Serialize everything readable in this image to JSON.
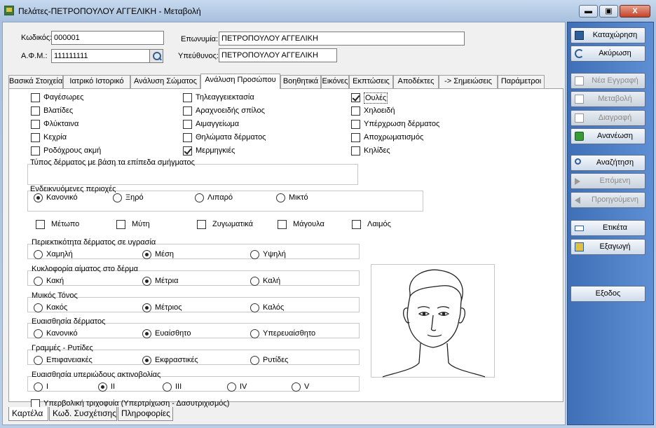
{
  "window": {
    "title": "Πελάτες-ΠΕΤΡΟΠΟΥΛΟΥ ΑΓΓΕΛΙΚΗ -  Μεταβολή",
    "min_label": "▬",
    "max_label": "▣",
    "close_label": "X"
  },
  "header": {
    "code_label": "Κωδικός:",
    "code_value": "000001",
    "afm_label": "Α.Φ.Μ.:",
    "afm_value": "111111111",
    "name_label": "Επωνυμία:",
    "name_value": "ΠΕΤΡΟΠΟΥΛΟΥ ΑΓΓΕΛΙΚΗ",
    "resp_label": "Υπεύθυνος:",
    "resp_value": "ΠΕΤΡΟΠΟΥΛΟΥ ΑΓΓΕΛΙΚΗ"
  },
  "tabs": [
    {
      "label": "Βασικά Στοιχεία"
    },
    {
      "label": "Ιατρικό Ιστορικό"
    },
    {
      "label": "Ανάλυση Σώματος"
    },
    {
      "label": "Ανάλυση Προσώπου"
    },
    {
      "label": "Βοηθητικά"
    },
    {
      "label": "Εικόνες"
    },
    {
      "label": "Εκπτώσεις"
    },
    {
      "label": "Αποδέκτες"
    },
    {
      "label": "-> Σημειώσεις"
    },
    {
      "label": "Παράμετροι"
    }
  ],
  "active_tab": "Ανάλυση Προσώπου",
  "conditions": [
    {
      "label": "Φαγέσωρες",
      "checked": false
    },
    {
      "label": "Βλατίδες",
      "checked": false
    },
    {
      "label": "Φλύκταινα",
      "checked": false
    },
    {
      "label": "Κεχρία",
      "checked": false
    },
    {
      "label": "Ροδόχρους ακμή",
      "checked": false
    },
    {
      "label": "Τηλεαγγειεκτασία",
      "checked": false
    },
    {
      "label": "Αραχνοειδής σπίλος",
      "checked": false
    },
    {
      "label": "Αιμαγγείωμα",
      "checked": false
    },
    {
      "label": "Θηλώματα δέρματος",
      "checked": false
    },
    {
      "label": "Μερμηγκιές",
      "checked": true
    },
    {
      "label": "Ουλές",
      "checked": true
    },
    {
      "label": "Χηλοειδή",
      "checked": false
    },
    {
      "label": "Υπέρχρωση δέρματος",
      "checked": false
    },
    {
      "label": "Αποχρωματισμός",
      "checked": false
    },
    {
      "label": "Κηλίδες",
      "checked": false
    }
  ],
  "skin_type": {
    "title": "Τύπος δέρματος με βάση τα επίπεδα σμήγματος",
    "options": [
      "Κανονικό",
      "Ξηρό",
      "Λιπαρό",
      "Μικτό"
    ],
    "selected": "Κανονικό"
  },
  "areas": {
    "title": "Ενδεικνυόμενες περιοχές",
    "items": [
      {
        "label": "Μέτωπο",
        "checked": false
      },
      {
        "label": "Μύτη",
        "checked": false
      },
      {
        "label": "Ζυγωματικά",
        "checked": false
      },
      {
        "label": "Μάγουλα",
        "checked": false
      },
      {
        "label": "Λαιμός",
        "checked": false
      }
    ]
  },
  "moisture": {
    "title": "Περιεκτικότητα δέρματος σε υγρασία",
    "options": [
      "Χαμηλή",
      "Μέση",
      "Υψηλή"
    ],
    "selected": "Μέση"
  },
  "circulation": {
    "title": "Κυκλοφορία αίματος στο δέρμα",
    "options": [
      "Κακή",
      "Μέτρια",
      "Καλή"
    ],
    "selected": "Μέτρια"
  },
  "muscle_tone": {
    "title": "Μυικός Τόνος",
    "options": [
      "Κακός",
      "Μέτριος",
      "Καλός"
    ],
    "selected": "Μέτριος"
  },
  "sensitivity": {
    "title": "Ευαισθησία δέρματος",
    "options": [
      "Κανονικό",
      "Ευαίσθητο",
      "Υπερευαίσθητο"
    ],
    "selected": "Ευαίσθητο"
  },
  "wrinkles": {
    "title": "Γραμμές - Ρυτίδες",
    "options": [
      "Επιφανειακές",
      "Εκφραστικές",
      "Ρυτίδες"
    ],
    "selected": "Εκφραστικές"
  },
  "uv": {
    "title": "Ευαισθησία υπεριώδους ακτινοβολίας",
    "options": [
      "I",
      "II",
      "III",
      "IV",
      "V"
    ],
    "selected": "II"
  },
  "hypertrichosis": {
    "label": "Υπερβολική τριχοφυία (Υπερτρίχωση - Δασυτριχισμός)",
    "checked": false
  },
  "bottom_tabs": [
    {
      "label": "Καρτέλα"
    },
    {
      "label": "Κωδ. Συσχέτισης"
    },
    {
      "label": "Πληροφορίες"
    }
  ],
  "sidebar": {
    "buttons": [
      {
        "label": "Καταχώρηση",
        "icon": "save-icon",
        "enabled": true
      },
      {
        "label": "Ακύρωση",
        "icon": "undo-icon",
        "enabled": true
      },
      {
        "label": "Νέα Εγγραφή",
        "icon": "new-record-icon",
        "enabled": false
      },
      {
        "label": "Μεταβολή",
        "icon": "edit-icon",
        "enabled": false
      },
      {
        "label": "Διαγραφή",
        "icon": "delete-icon",
        "enabled": false
      },
      {
        "label": "Ανανέωση",
        "icon": "refresh-icon",
        "enabled": true
      },
      {
        "label": "Αναζήτηση",
        "icon": "search-icon",
        "enabled": true
      },
      {
        "label": "Επόμενη",
        "icon": "arrow-right-icon",
        "enabled": false
      },
      {
        "label": "Προηγούμενη",
        "icon": "arrow-left-icon",
        "enabled": false
      },
      {
        "label": "Ετικέτα",
        "icon": "label-icon",
        "enabled": true
      },
      {
        "label": "Εξαγωγή",
        "icon": "export-icon",
        "enabled": true
      },
      {
        "label": "Εξοδος",
        "icon": "",
        "enabled": true
      }
    ]
  },
  "colors": {
    "sidebar": "#4a7dc6",
    "titlebar": "#b9cde6",
    "close": "#c3432a"
  }
}
